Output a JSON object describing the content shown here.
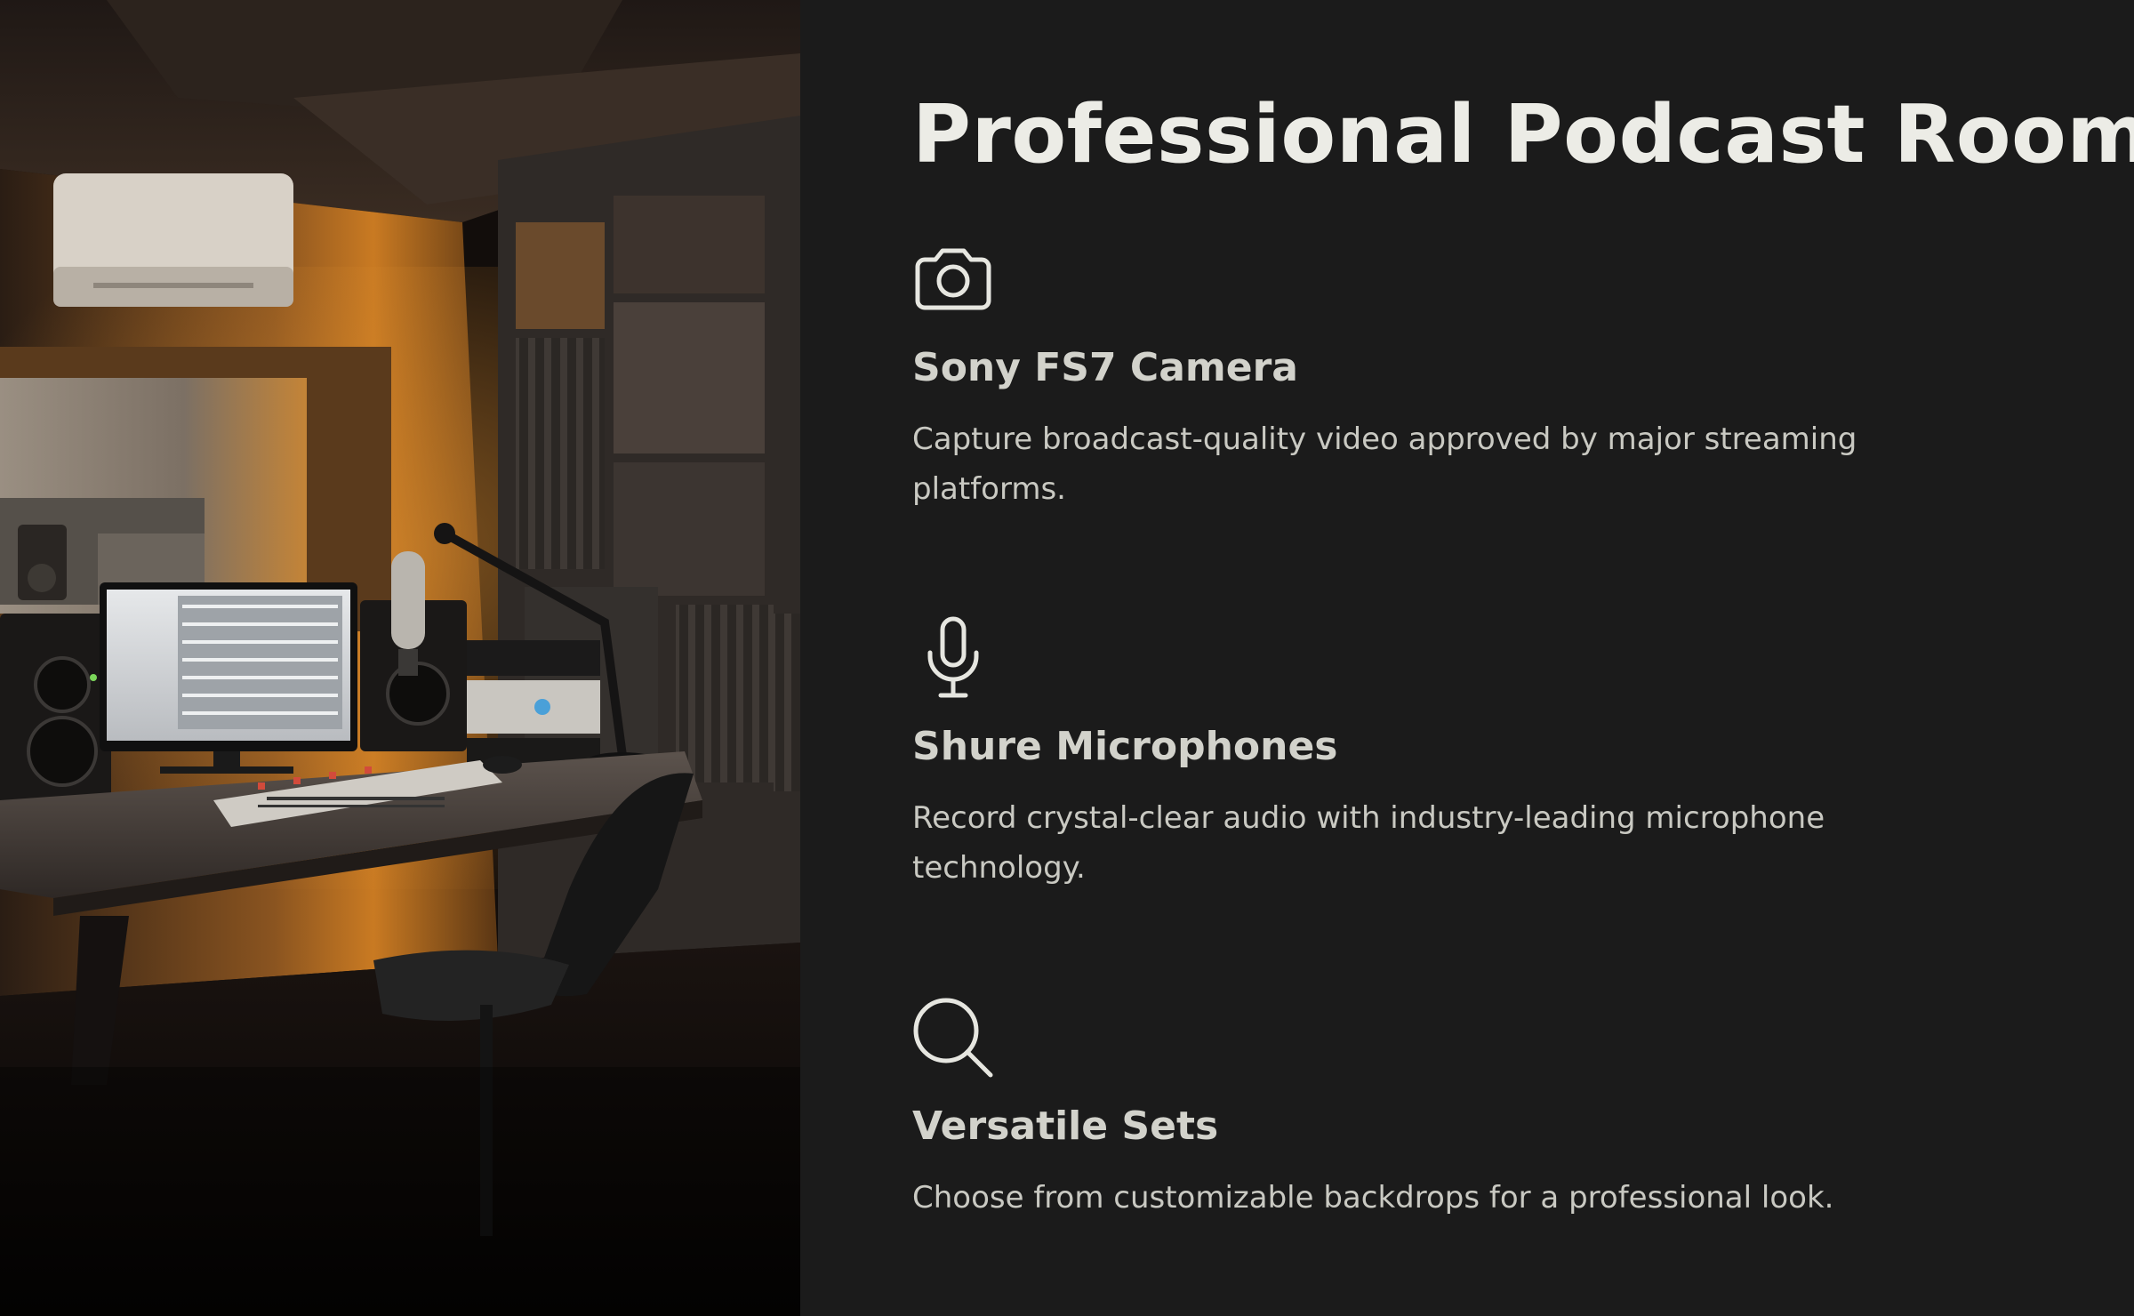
{
  "page": {
    "title": "Professional Podcast Room",
    "background_color": "#1b1b1b",
    "text_color": "#ecece6"
  },
  "photo": {
    "subject": "podcast studio with monitor, mixing console, studio microphone and chair"
  },
  "features": [
    {
      "icon": "camera-icon",
      "title": "Sony FS7 Camera",
      "description": "Capture broadcast-quality video approved by major streaming platforms."
    },
    {
      "icon": "microphone-icon",
      "title": "Shure Microphones",
      "description": "Record crystal-clear audio with industry-leading microphone technology."
    },
    {
      "icon": "search-icon",
      "title": "Versatile Sets",
      "description": "Choose from customizable backdrops for a professional look."
    }
  ]
}
